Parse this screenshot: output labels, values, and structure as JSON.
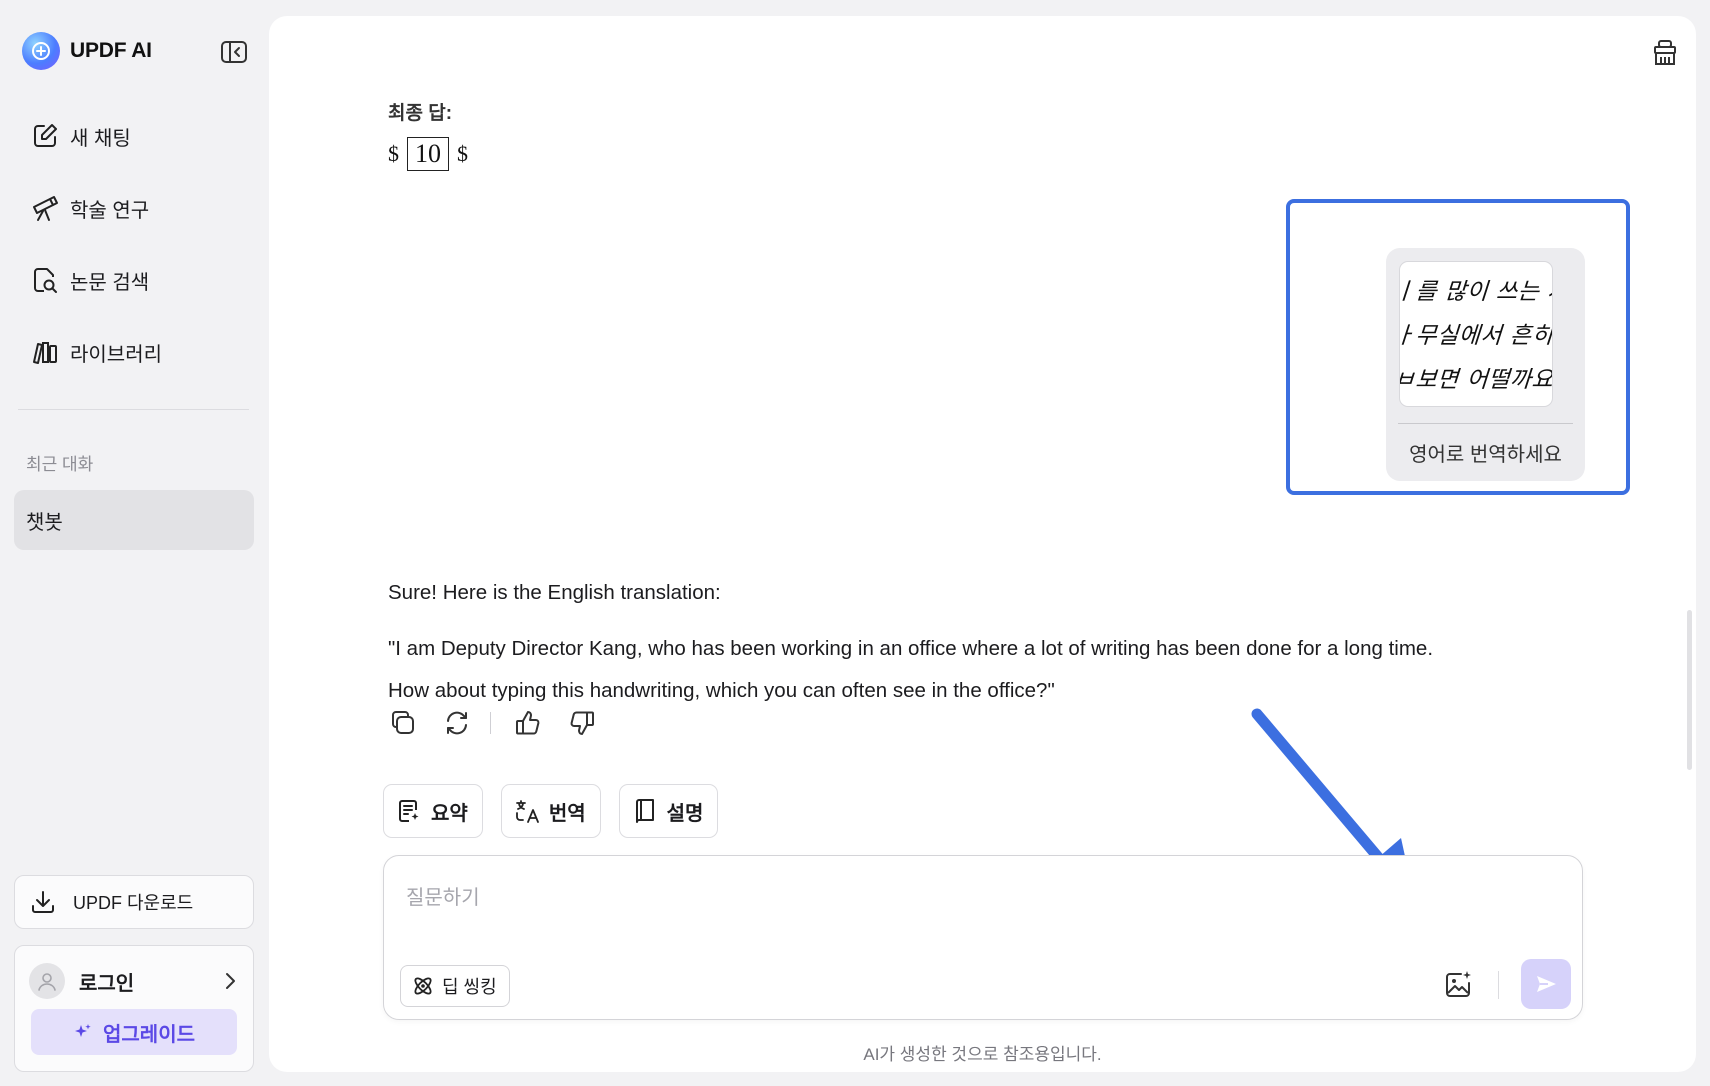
{
  "sidebar": {
    "brand_name": "UPDF AI",
    "collapse_icon": "sidebar-collapse-icon",
    "nav": [
      {
        "label": "새 채팅",
        "icon": "edit-icon"
      },
      {
        "label": "학술 연구",
        "icon": "telescope-icon"
      },
      {
        "label": "논문 검색",
        "icon": "document-search-icon"
      },
      {
        "label": "라이브러리",
        "icon": "library-icon"
      }
    ],
    "recent_title": "최근 대화",
    "recent_items": [
      "챗봇"
    ],
    "download_label": "UPDF 다운로드",
    "login_label": "로그인",
    "upgrade_label": "업그레이드"
  },
  "chat": {
    "final_answer_title": "최종 답:",
    "final_answer": {
      "prefix": "$",
      "value": "10",
      "suffix": "$"
    },
    "user_message": {
      "image_lines": [
        "ㅣ를 많이 쓰는 사",
        "ㅏ무실에서 흔히",
        "ㅂ보면 어떨까요?"
      ],
      "text": "영어로 번역하세요"
    },
    "response": {
      "intro": "Sure! Here is the English translation:",
      "line1": "\"I am Deputy Director Kang, who has been working in an office where a lot of writing has been done for a long time.",
      "line2": "How about typing this handwriting, which you can often see in the office?\""
    },
    "actions": [
      "copy-icon",
      "regenerate-icon",
      "thumbs-up-icon",
      "thumbs-down-icon"
    ]
  },
  "quick_actions": [
    {
      "label": "요약",
      "icon": "summary-icon"
    },
    {
      "label": "번역",
      "icon": "translate-icon"
    },
    {
      "label": "설명",
      "icon": "book-icon"
    }
  ],
  "composer": {
    "placeholder": "질문하기",
    "value": "",
    "deep_thinking_label": "딥 씽킹"
  },
  "disclaimer": "AI가 생성한 것으로 참조용입니다.",
  "colors": {
    "accent": "#5b49e6",
    "upgrade_bg": "#e4e0fb",
    "highlight_border": "#3c6fe0",
    "arrow": "#3c6fe0",
    "send_bg": "#d6d2fa"
  }
}
